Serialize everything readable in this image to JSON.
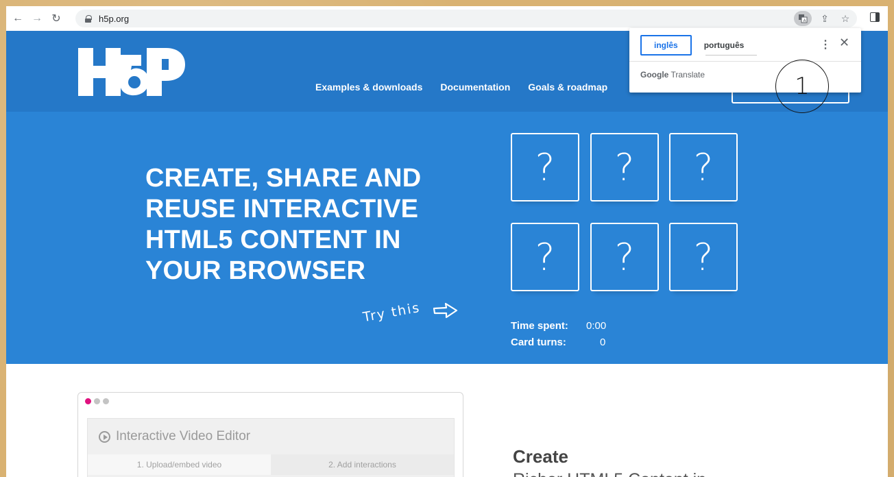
{
  "browser": {
    "url": "h5p.org",
    "back_icon": "←",
    "forward_icon": "→",
    "reload_icon": "↻",
    "share_icon": "⇪",
    "star_icon": "☆"
  },
  "site": {
    "nav": [
      "Examples & downloads",
      "Documentation",
      "Goals & roadmap"
    ]
  },
  "hero": {
    "title": "CREATE, SHARE AND REUSE INTERACTIVE HTML5 CONTENT IN YOUR BROWSER",
    "try_this": "Try this",
    "cards": [
      "?",
      "?",
      "?",
      "?",
      "?",
      "?"
    ],
    "stats": {
      "time_label": "Time spent:",
      "time_value": "0:00",
      "turns_label": "Card turns:",
      "turns_value": "0"
    }
  },
  "editor": {
    "title": "Interactive Video Editor",
    "tabs": [
      "1. Upload/embed video",
      "2. Add interactions"
    ]
  },
  "create_section": {
    "title": "Create",
    "subtitle": "Richer HTML5 Content in"
  },
  "translate_popup": {
    "tabs": [
      "inglês",
      "português"
    ],
    "footer_brand": "Google",
    "footer_product": "Translate",
    "more_icon": "⋮",
    "close_icon": "✕"
  },
  "annotation": {
    "label": "1"
  },
  "colors": {
    "header_blue": "#2578c8",
    "hero_blue": "#2a84d6",
    "translate_blue": "#1a73e8"
  }
}
